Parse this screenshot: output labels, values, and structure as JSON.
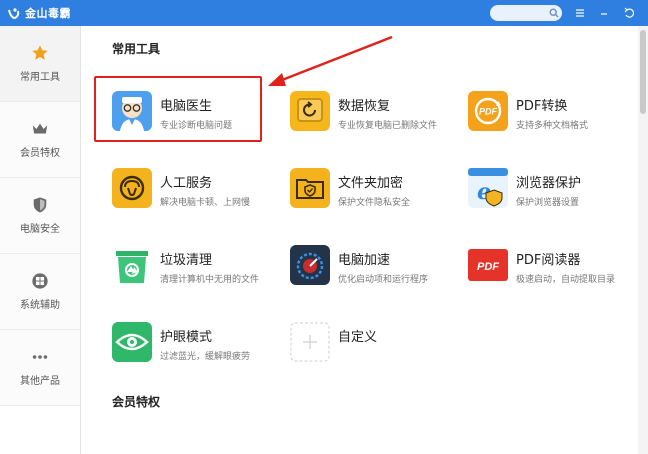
{
  "app": {
    "title": "金山毒霸"
  },
  "search": {
    "placeholder": ""
  },
  "titlebar": {
    "menu_icon": "menu-icon",
    "min_icon": "minimize-icon",
    "back_icon": "back-icon"
  },
  "sidebar": {
    "items": [
      {
        "label": "常用工具",
        "icon": "star-icon",
        "active": true
      },
      {
        "label": "会员特权",
        "icon": "crown-icon",
        "active": false
      },
      {
        "label": "电脑安全",
        "icon": "shield-icon",
        "active": false
      },
      {
        "label": "系统辅助",
        "icon": "windows-icon",
        "active": false
      },
      {
        "label": "其他产品",
        "icon": "more-icon",
        "active": false
      }
    ]
  },
  "main": {
    "section_common": "常用工具",
    "section_vip": "会员特权",
    "tools": [
      {
        "name": "电脑医生",
        "desc": "专业诊断电脑问题",
        "icon": "doctor-icon"
      },
      {
        "name": "数据恢复",
        "desc": "专业恢复电脑已删除文件",
        "icon": "data-recovery-icon"
      },
      {
        "name": "PDF转换",
        "desc": "支持多种文档格式",
        "icon": "pdf-convert-icon"
      },
      {
        "name": "人工服务",
        "desc": "解决电脑卡顿、上网慢",
        "icon": "human-service-icon"
      },
      {
        "name": "文件夹加密",
        "desc": "保护文件隐私安全",
        "icon": "folder-encrypt-icon"
      },
      {
        "name": "浏览器保护",
        "desc": "保护浏览器设置",
        "icon": "browser-protect-icon"
      },
      {
        "name": "垃圾清理",
        "desc": "清理计算机中无用的文件",
        "icon": "trash-clean-icon"
      },
      {
        "name": "电脑加速",
        "desc": "优化启动项和运行程序",
        "icon": "speedup-icon"
      },
      {
        "name": "PDF阅读器",
        "desc": "极速启动，自动提取目录",
        "icon": "pdf-reader-icon"
      },
      {
        "name": "护眼模式",
        "desc": "过滤蓝光，缓解眼疲劳",
        "icon": "eye-care-icon"
      },
      {
        "name": "自定义",
        "desc": "",
        "icon": "add-custom-icon"
      }
    ]
  },
  "colors": {
    "titlebar": "#2f7fe0",
    "highlight": "#e0221b",
    "accent_orange": "#f0a21a"
  }
}
